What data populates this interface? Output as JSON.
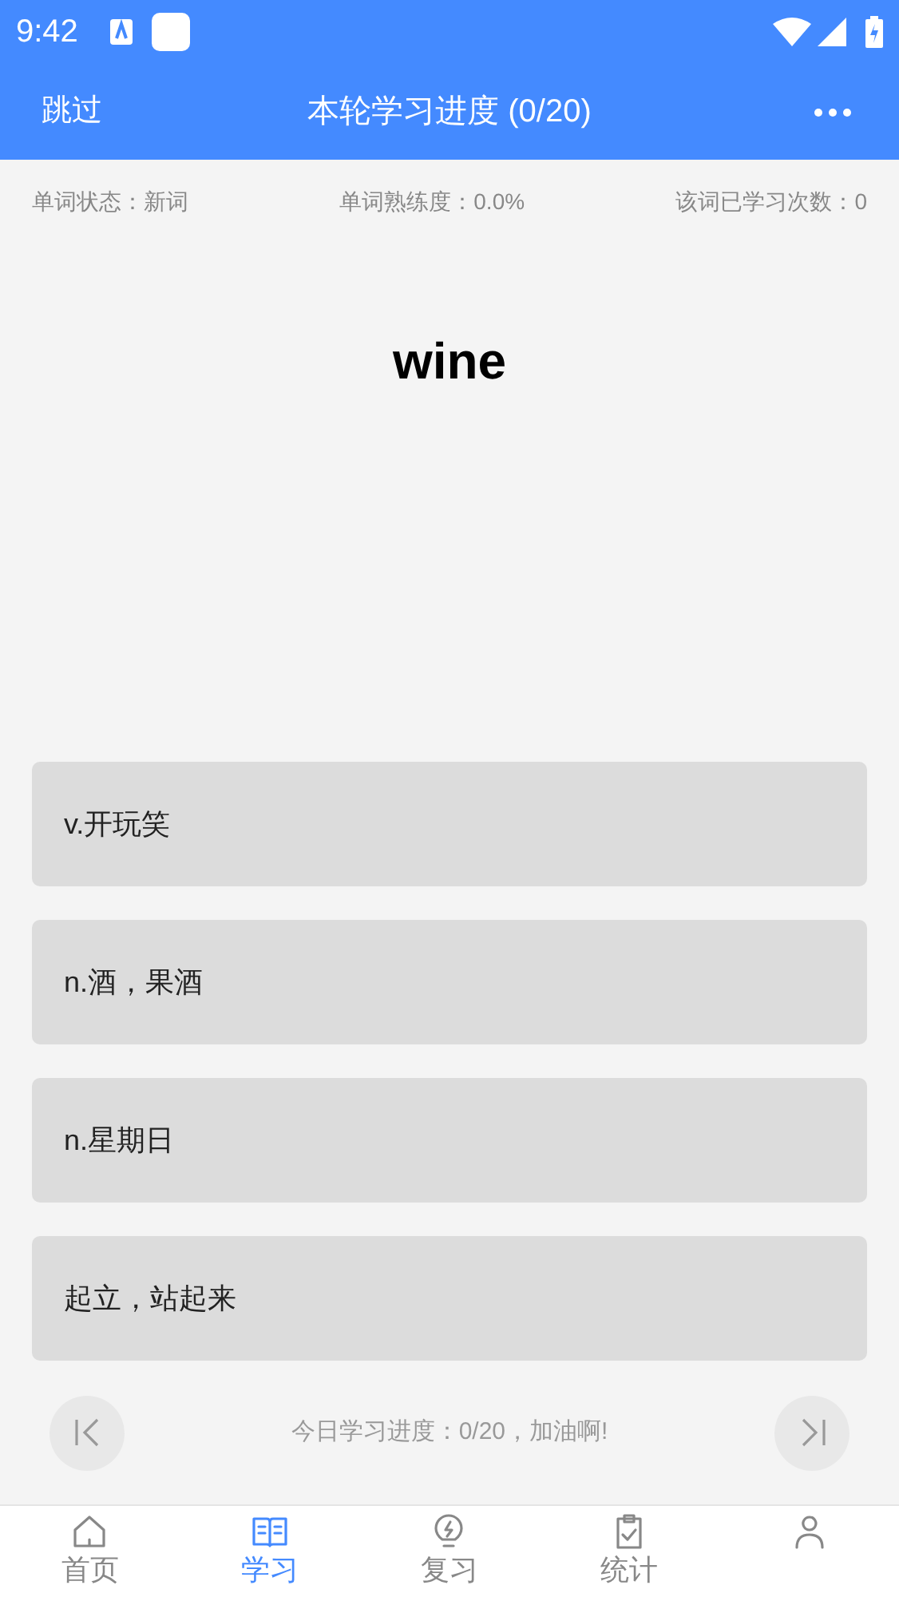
{
  "status_bar": {
    "time": "9:42"
  },
  "header": {
    "back": "跳过",
    "title": "本轮学习进度 (0/20)"
  },
  "info": [
    "单词状态：新词",
    "单词熟练度：0.0%",
    "该词已学习次数：0"
  ],
  "word": "wine",
  "options": [
    {
      "text": "v.开玩笑"
    },
    {
      "text": "n.酒，果酒"
    },
    {
      "text": "n.星期日"
    },
    {
      "text": "起立，站起来"
    }
  ],
  "progress": "今日学习进度：0/20，加油啊!",
  "tabs": [
    {
      "kind": "home",
      "label": "首页",
      "selected": false
    },
    {
      "kind": "book",
      "label": "学习",
      "selected": true
    },
    {
      "kind": "bulb",
      "label": "复习",
      "selected": false
    },
    {
      "kind": "clipboard",
      "label": "统计",
      "selected": false
    },
    {
      "kind": "person",
      "selected": false
    }
  ]
}
